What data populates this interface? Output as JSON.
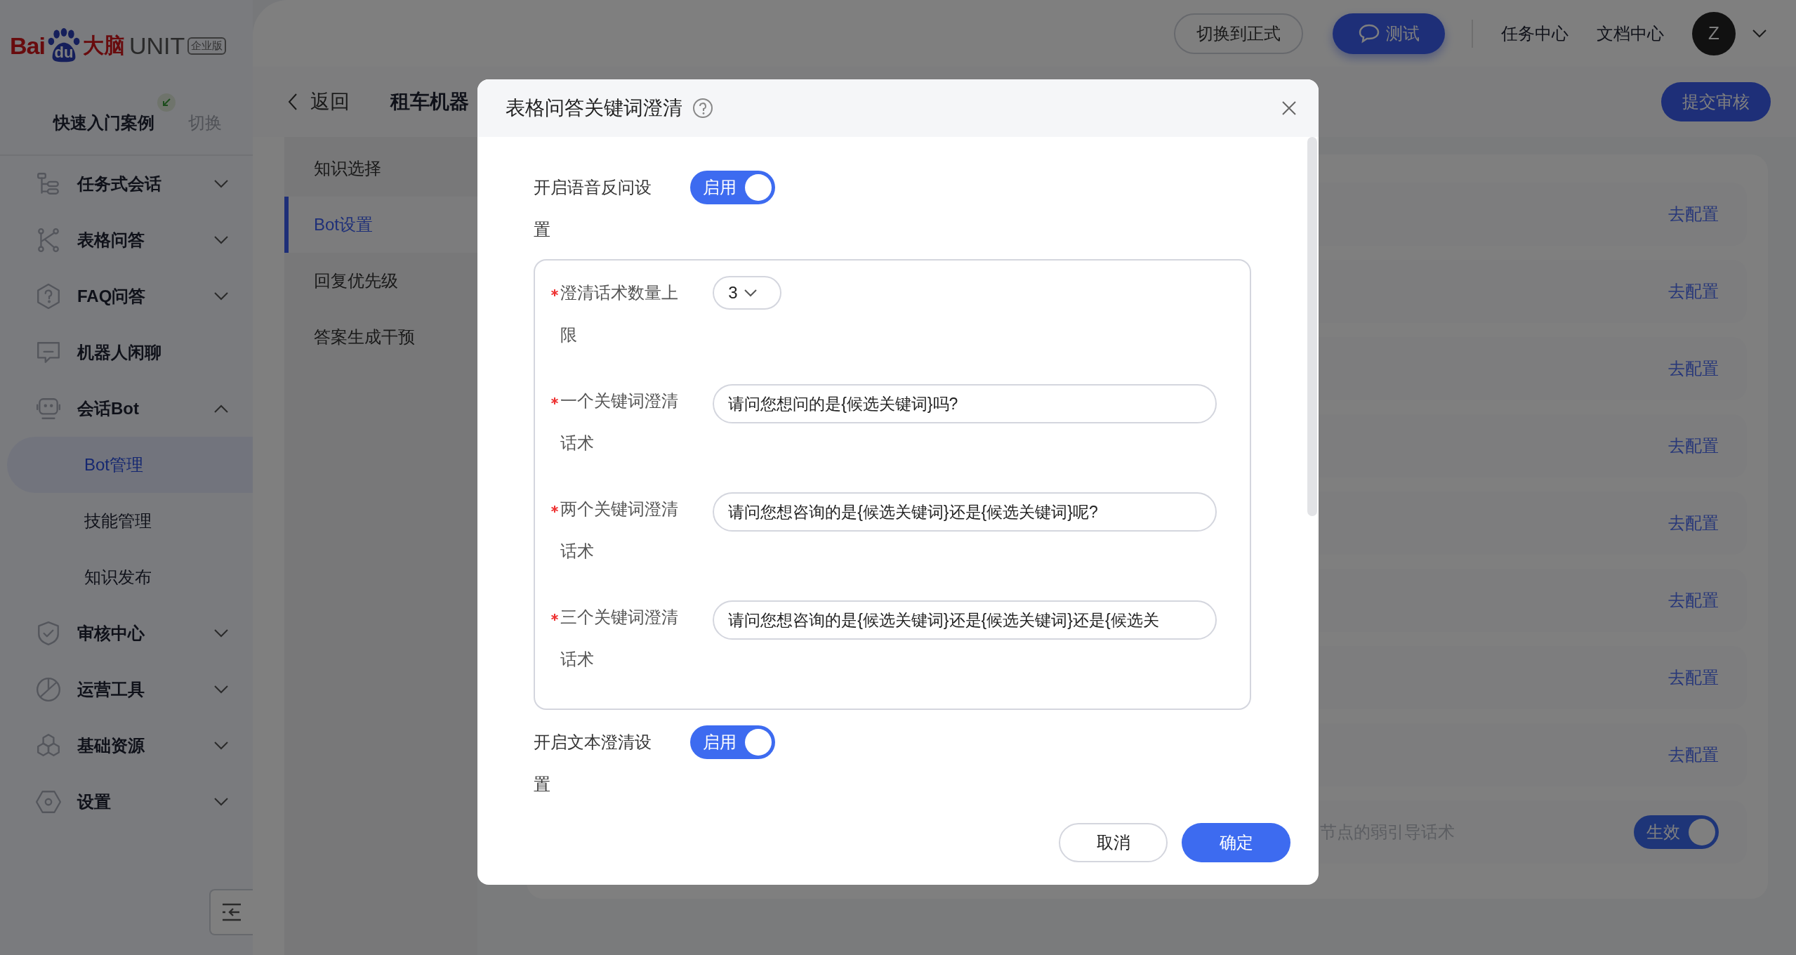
{
  "brand": {
    "text1": "Bai",
    "paw_text": "du",
    "text2": "大脑",
    "product": "UNIT",
    "edition": "企业版"
  },
  "quick_start": {
    "label": "快速入门案例",
    "switch": "切换"
  },
  "sidebar": {
    "items": [
      {
        "label": "任务式会话",
        "kind": "group",
        "expanded": false
      },
      {
        "label": "表格问答",
        "kind": "group",
        "expanded": false
      },
      {
        "label": "FAQ问答",
        "kind": "group",
        "expanded": false
      },
      {
        "label": "机器人闲聊",
        "kind": "link"
      },
      {
        "label": "会话Bot",
        "kind": "group",
        "expanded": true,
        "children": [
          {
            "label": "Bot管理",
            "selected": true
          },
          {
            "label": "技能管理",
            "selected": false
          },
          {
            "label": "知识发布",
            "selected": false
          }
        ]
      },
      {
        "label": "审核中心",
        "kind": "group",
        "expanded": false
      },
      {
        "label": "运营工具",
        "kind": "group",
        "expanded": false
      },
      {
        "label": "基础资源",
        "kind": "group",
        "expanded": false
      },
      {
        "label": "设置",
        "kind": "group",
        "expanded": false
      }
    ]
  },
  "header": {
    "switch_button": "切换到正式",
    "test_button": "测试",
    "links": [
      "任务中心",
      "文档中心"
    ],
    "avatar": "Z"
  },
  "subheader": {
    "back": "返回",
    "title": "租车机器",
    "submit": "提交审核"
  },
  "subnav": [
    {
      "label": "知识选择",
      "selected": false
    },
    {
      "label": "Bot设置",
      "selected": true
    },
    {
      "label": "回复优先级",
      "selected": false
    },
    {
      "label": "答案生成干预",
      "selected": false
    }
  ],
  "content": {
    "rows": [
      {
        "kind": "link",
        "action": "去配置"
      },
      {
        "kind": "link",
        "action": "去配置"
      },
      {
        "kind": "link",
        "action": "去配置"
      },
      {
        "kind": "link",
        "action": "去配置"
      },
      {
        "kind": "link",
        "action": "去配置"
      },
      {
        "kind": "link",
        "action": "去配置"
      },
      {
        "kind": "link",
        "action": "去配置"
      },
      {
        "kind": "link",
        "action": "去配置"
      },
      {
        "kind": "toggle",
        "label": "节点的弱引导话术",
        "toggle": {
          "label": "生效",
          "on": true
        }
      }
    ]
  },
  "dialog": {
    "title": "表格问答关键词澄清",
    "voice": {
      "label": "开启语音反问设置",
      "toggle": {
        "label": "启用",
        "on": true
      }
    },
    "fields": [
      {
        "kind": "select",
        "label": "澄清话术数量上限",
        "required": true,
        "value": "3"
      },
      {
        "kind": "input",
        "label": "一个关键词澄清话术",
        "required": true,
        "value": "请问您想问的是{候选关键词}吗?"
      },
      {
        "kind": "input",
        "label": "两个关键词澄清话术",
        "required": true,
        "value": "请问您想咨询的是{候选关键词}还是{候选关键词}呢?"
      },
      {
        "kind": "input",
        "label": "三个关键词澄清话术",
        "required": true,
        "value": "请问您想咨询的是{候选关键词}还是{候选关键词}还是{候选关"
      }
    ],
    "text": {
      "label": "开启文本澄清设置",
      "toggle": {
        "label": "启用",
        "on": true
      }
    },
    "buttons": [
      {
        "kind": "secondary",
        "label": "取消"
      },
      {
        "kind": "primary",
        "label": "确定"
      }
    ]
  }
}
